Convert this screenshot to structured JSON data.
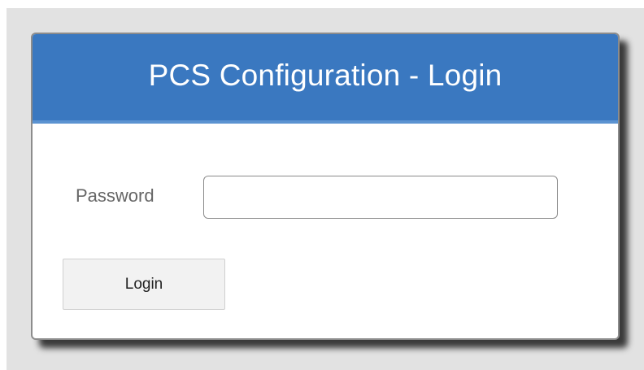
{
  "dialog": {
    "title": "PCS Configuration - Login",
    "password_label": "Password",
    "password_value": "",
    "login_label": "Login"
  },
  "colors": {
    "header": "#3a78c0",
    "backdrop": "#e2e2e2",
    "button": "#f2f2f2"
  }
}
